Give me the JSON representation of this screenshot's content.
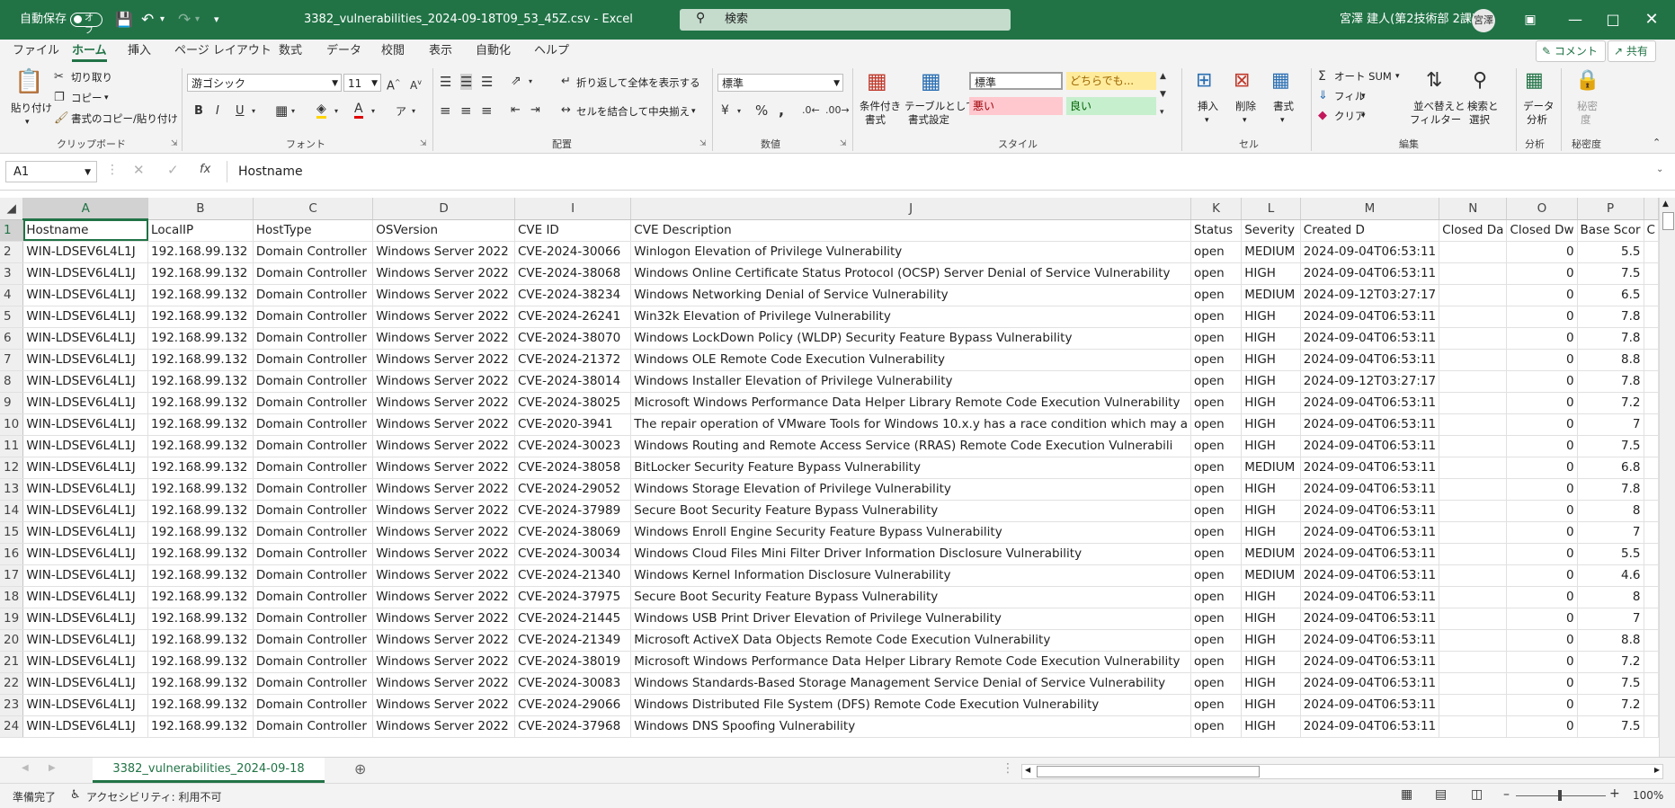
{
  "titlebar": {
    "autosave_label": "自動保存",
    "autosave_state": "オフ",
    "filename": "3382_vulnerabilities_2024-09-18T09_53_45Z.csv  -  Excel",
    "search_placeholder": "検索",
    "user_name": "宮澤 建人(第2技術部 2課)",
    "user_initials": "宮澤"
  },
  "tabs": [
    "ファイル",
    "ホーム",
    "挿入",
    "ページ レイアウト",
    "数式",
    "データ",
    "校閲",
    "表示",
    "自動化",
    "ヘルプ"
  ],
  "active_tab": "ホーム",
  "actions": {
    "comment": "コメント",
    "share": "共有"
  },
  "ribbon": {
    "clipboard": {
      "paste": "貼り付け",
      "cut": "切り取り",
      "copy": "コピー",
      "format_painter": "書式のコピー/貼り付け",
      "group": "クリップボード"
    },
    "font": {
      "name": "游ゴシック",
      "size": "11",
      "group": "フォント"
    },
    "alignment": {
      "wrap": "折り返して全体を表示する",
      "merge": "セルを結合して中央揃え",
      "group": "配置"
    },
    "number": {
      "format": "標準",
      "group": "数値"
    },
    "styles": {
      "conditional_line1": "条件付き",
      "conditional_line2": "書式",
      "table_line1": "テーブルとして",
      "table_line2": "書式設定",
      "normal": "標準",
      "neutral": "どちらでも...",
      "bad": "悪い",
      "good": "良い",
      "group": "スタイル"
    },
    "cells": {
      "insert": "挿入",
      "delete": "削除",
      "format": "書式",
      "group": "セル"
    },
    "editing": {
      "autosum": "オート SUM",
      "fill": "フィル",
      "clear": "クリア",
      "sort_line1": "並べ替えと",
      "sort_line2": "フィルター",
      "find_line1": "検索と",
      "find_line2": "選択",
      "group": "編集"
    },
    "analysis": {
      "line1": "データ",
      "line2": "分析",
      "group": "分析"
    },
    "sensitivity": {
      "line1": "秘密",
      "line2": "度",
      "group": "秘密度"
    }
  },
  "formula_bar": {
    "cell_ref": "A1",
    "fx": "fx",
    "content": "Hostname"
  },
  "grid": {
    "columns": [
      "A",
      "B",
      "C",
      "D",
      "I",
      "J",
      "K",
      "L",
      "M",
      "N",
      "O",
      "P",
      ""
    ],
    "header_row": [
      "Hostname",
      "LocalIP",
      "HostType",
      "OSVersion",
      "CVE ID",
      "CVE Description",
      "Status",
      "Severity",
      "Created D",
      "Closed Da",
      "Closed Dw",
      "Base Scor",
      "C"
    ],
    "rows": [
      [
        "WIN-LDSEV6L4L1J",
        "192.168.99.132",
        "Domain Controller",
        "Windows Server 2022",
        "CVE-2024-30066",
        "Winlogon Elevation of Privilege Vulnerability",
        "open",
        "MEDIUM",
        "2024-09-04T06:53:11",
        "",
        "0",
        "5.5"
      ],
      [
        "WIN-LDSEV6L4L1J",
        "192.168.99.132",
        "Domain Controller",
        "Windows Server 2022",
        "CVE-2024-38068",
        "Windows Online Certificate Status Protocol (OCSP) Server Denial of Service Vulnerability",
        "open",
        "HIGH",
        "2024-09-04T06:53:11",
        "",
        "0",
        "7.5"
      ],
      [
        "WIN-LDSEV6L4L1J",
        "192.168.99.132",
        "Domain Controller",
        "Windows Server 2022",
        "CVE-2024-38234",
        "Windows Networking Denial of Service Vulnerability",
        "open",
        "MEDIUM",
        "2024-09-12T03:27:17",
        "",
        "0",
        "6.5"
      ],
      [
        "WIN-LDSEV6L4L1J",
        "192.168.99.132",
        "Domain Controller",
        "Windows Server 2022",
        "CVE-2024-26241",
        "Win32k Elevation of Privilege Vulnerability",
        "open",
        "HIGH",
        "2024-09-04T06:53:11",
        "",
        "0",
        "7.8"
      ],
      [
        "WIN-LDSEV6L4L1J",
        "192.168.99.132",
        "Domain Controller",
        "Windows Server 2022",
        "CVE-2024-38070",
        "Windows LockDown Policy (WLDP) Security Feature Bypass Vulnerability",
        "open",
        "HIGH",
        "2024-09-04T06:53:11",
        "",
        "0",
        "7.8"
      ],
      [
        "WIN-LDSEV6L4L1J",
        "192.168.99.132",
        "Domain Controller",
        "Windows Server 2022",
        "CVE-2024-21372",
        "Windows OLE Remote Code Execution Vulnerability",
        "open",
        "HIGH",
        "2024-09-04T06:53:11",
        "",
        "0",
        "8.8"
      ],
      [
        "WIN-LDSEV6L4L1J",
        "192.168.99.132",
        "Domain Controller",
        "Windows Server 2022",
        "CVE-2024-38014",
        "Windows Installer Elevation of Privilege Vulnerability",
        "open",
        "HIGH",
        "2024-09-12T03:27:17",
        "",
        "0",
        "7.8"
      ],
      [
        "WIN-LDSEV6L4L1J",
        "192.168.99.132",
        "Domain Controller",
        "Windows Server 2022",
        "CVE-2024-38025",
        "Microsoft Windows Performance Data Helper Library Remote Code Execution Vulnerability",
        "open",
        "HIGH",
        "2024-09-04T06:53:11",
        "",
        "0",
        "7.2"
      ],
      [
        "WIN-LDSEV6L4L1J",
        "192.168.99.132",
        "Domain Controller",
        "Windows Server 2022",
        "CVE-2020-3941",
        "The repair operation of VMware Tools for Windows 10.x.y has a race condition which may a",
        "open",
        "HIGH",
        "2024-09-04T06:53:11",
        "",
        "0",
        "7"
      ],
      [
        "WIN-LDSEV6L4L1J",
        "192.168.99.132",
        "Domain Controller",
        "Windows Server 2022",
        "CVE-2024-30023",
        "Windows Routing and Remote Access Service (RRAS) Remote Code Execution Vulnerabili",
        "open",
        "HIGH",
        "2024-09-04T06:53:11",
        "",
        "0",
        "7.5"
      ],
      [
        "WIN-LDSEV6L4L1J",
        "192.168.99.132",
        "Domain Controller",
        "Windows Server 2022",
        "CVE-2024-38058",
        "BitLocker Security Feature Bypass Vulnerability",
        "open",
        "MEDIUM",
        "2024-09-04T06:53:11",
        "",
        "0",
        "6.8"
      ],
      [
        "WIN-LDSEV6L4L1J",
        "192.168.99.132",
        "Domain Controller",
        "Windows Server 2022",
        "CVE-2024-29052",
        "Windows Storage Elevation of Privilege Vulnerability",
        "open",
        "HIGH",
        "2024-09-04T06:53:11",
        "",
        "0",
        "7.8"
      ],
      [
        "WIN-LDSEV6L4L1J",
        "192.168.99.132",
        "Domain Controller",
        "Windows Server 2022",
        "CVE-2024-37989",
        "Secure Boot Security Feature Bypass Vulnerability",
        "open",
        "HIGH",
        "2024-09-04T06:53:11",
        "",
        "0",
        "8"
      ],
      [
        "WIN-LDSEV6L4L1J",
        "192.168.99.132",
        "Domain Controller",
        "Windows Server 2022",
        "CVE-2024-38069",
        "Windows Enroll Engine Security Feature Bypass Vulnerability",
        "open",
        "HIGH",
        "2024-09-04T06:53:11",
        "",
        "0",
        "7"
      ],
      [
        "WIN-LDSEV6L4L1J",
        "192.168.99.132",
        "Domain Controller",
        "Windows Server 2022",
        "CVE-2024-30034",
        "Windows Cloud Files Mini Filter Driver Information Disclosure Vulnerability",
        "open",
        "MEDIUM",
        "2024-09-04T06:53:11",
        "",
        "0",
        "5.5"
      ],
      [
        "WIN-LDSEV6L4L1J",
        "192.168.99.132",
        "Domain Controller",
        "Windows Server 2022",
        "CVE-2024-21340",
        "Windows Kernel Information Disclosure Vulnerability",
        "open",
        "MEDIUM",
        "2024-09-04T06:53:11",
        "",
        "0",
        "4.6"
      ],
      [
        "WIN-LDSEV6L4L1J",
        "192.168.99.132",
        "Domain Controller",
        "Windows Server 2022",
        "CVE-2024-37975",
        "Secure Boot Security Feature Bypass Vulnerability",
        "open",
        "HIGH",
        "2024-09-04T06:53:11",
        "",
        "0",
        "8"
      ],
      [
        "WIN-LDSEV6L4L1J",
        "192.168.99.132",
        "Domain Controller",
        "Windows Server 2022",
        "CVE-2024-21445",
        "Windows USB Print Driver Elevation of Privilege Vulnerability",
        "open",
        "HIGH",
        "2024-09-04T06:53:11",
        "",
        "0",
        "7"
      ],
      [
        "WIN-LDSEV6L4L1J",
        "192.168.99.132",
        "Domain Controller",
        "Windows Server 2022",
        "CVE-2024-21349",
        "Microsoft ActiveX Data Objects Remote Code Execution Vulnerability",
        "open",
        "HIGH",
        "2024-09-04T06:53:11",
        "",
        "0",
        "8.8"
      ],
      [
        "WIN-LDSEV6L4L1J",
        "192.168.99.132",
        "Domain Controller",
        "Windows Server 2022",
        "CVE-2024-38019",
        "Microsoft Windows Performance Data Helper Library Remote Code Execution Vulnerability",
        "open",
        "HIGH",
        "2024-09-04T06:53:11",
        "",
        "0",
        "7.2"
      ],
      [
        "WIN-LDSEV6L4L1J",
        "192.168.99.132",
        "Domain Controller",
        "Windows Server 2022",
        "CVE-2024-30083",
        "Windows Standards-Based Storage Management Service Denial of Service Vulnerability",
        "open",
        "HIGH",
        "2024-09-04T06:53:11",
        "",
        "0",
        "7.5"
      ],
      [
        "WIN-LDSEV6L4L1J",
        "192.168.99.132",
        "Domain Controller",
        "Windows Server 2022",
        "CVE-2024-29066",
        "Windows Distributed File System (DFS) Remote Code Execution Vulnerability",
        "open",
        "HIGH",
        "2024-09-04T06:53:11",
        "",
        "0",
        "7.2"
      ],
      [
        "WIN-LDSEV6L4L1J",
        "192.168.99.132",
        "Domain Controller",
        "Windows Server 2022",
        "CVE-2024-37968",
        "Windows DNS Spoofing Vulnerability",
        "open",
        "HIGH",
        "2024-09-04T06:53:11",
        "",
        "0",
        "7.5"
      ]
    ]
  },
  "sheet_tab": "3382_vulnerabilities_2024-09-18",
  "status": {
    "ready": "準備完了",
    "accessibility": "アクセシビリティ: 利用不可",
    "zoom": "100%"
  },
  "colors": {
    "accent": "#217346",
    "neutral_bg": "#ffeb9c",
    "bad_bg": "#ffc7ce",
    "good_bg": "#c6efce"
  }
}
